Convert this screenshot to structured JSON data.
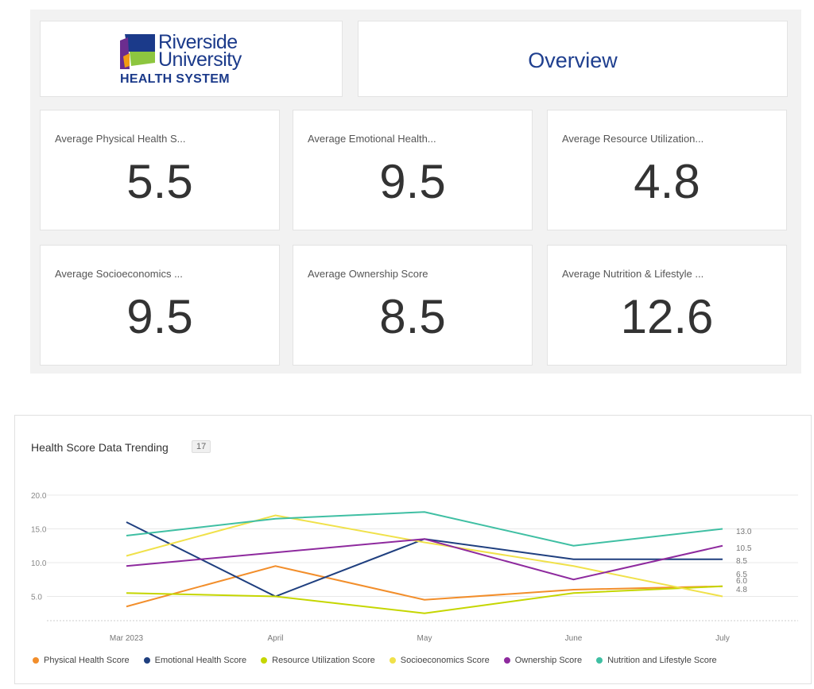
{
  "logo": {
    "line1": "Riverside",
    "line2": "University",
    "line3": "HEALTH SYSTEM",
    "colors": {
      "navy": "#1b3a8a",
      "purple": "#6b2d8f",
      "green": "#8dc63f",
      "orange": "#f39c12"
    }
  },
  "overview": {
    "title": "Overview"
  },
  "kpis": [
    {
      "label": "Average Physical Health S...",
      "value": "5.5"
    },
    {
      "label": "Average Emotional Health...",
      "value": "9.5"
    },
    {
      "label": "Average Resource Utilization...",
      "value": "4.8"
    },
    {
      "label": "Average Socioeconomics ...",
      "value": "9.5"
    },
    {
      "label": "Average Ownership Score",
      "value": "8.5"
    },
    {
      "label": "Average Nutrition & Lifestyle ...",
      "value": "12.6"
    }
  ],
  "chart": {
    "title": "Health Score Data Trending",
    "badge": "17"
  },
  "chart_data": {
    "type": "line",
    "title": "Health Score Data Trending",
    "x": [
      "Mar 2023",
      "April",
      "May",
      "June",
      "July"
    ],
    "ylim": [
      0,
      20
    ],
    "yticks": [
      "20.0",
      "15.0",
      "10.0",
      "5.0"
    ],
    "ytick_values": [
      20,
      15,
      10,
      5
    ],
    "grid": true,
    "legend_position": "bottom",
    "series": [
      {
        "name": "Physical Health Score",
        "color": "#f28e2b",
        "values": [
          3.5,
          9.5,
          4.5,
          6.0,
          6.5
        ],
        "end_label": "6.5"
      },
      {
        "name": "Emotional Health Score",
        "color": "#1f3f7f",
        "values": [
          16.0,
          5.0,
          13.5,
          10.5,
          10.5
        ],
        "end_label": "8.5"
      },
      {
        "name": "Resource Utilization Score",
        "color": "#c5d600",
        "values": [
          5.5,
          5.0,
          2.5,
          5.5,
          6.5
        ],
        "end_label": "6.0"
      },
      {
        "name": "Socioeconomics Score",
        "color": "#f0e14a",
        "values": [
          11.0,
          17.0,
          13.0,
          9.5,
          5.0
        ],
        "end_label": "4.8"
      },
      {
        "name": "Ownership Score",
        "color": "#8e2a9e",
        "values": [
          9.5,
          11.5,
          13.5,
          7.5,
          12.5
        ],
        "end_label": "10.5"
      },
      {
        "name": "Nutrition and Lifestyle Score",
        "color": "#3fbfa3",
        "values": [
          14.0,
          16.5,
          17.5,
          12.5,
          15.0
        ],
        "end_label": "13.0"
      }
    ],
    "end_labels_display": [
      "13.0",
      "10.5",
      "8.5",
      "6.5",
      "6.0",
      "4.8"
    ]
  }
}
